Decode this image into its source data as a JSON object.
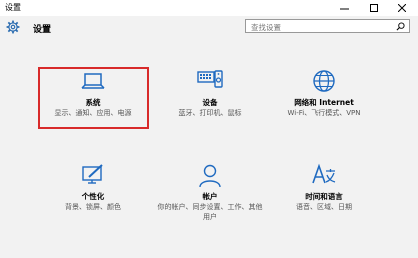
{
  "window": {
    "title": "设置"
  },
  "header": {
    "title": "设置",
    "search_placeholder": "查找设置"
  },
  "tiles": [
    {
      "title": "系统",
      "desc": "显示、通知、应用、电源",
      "icon": "laptop-icon"
    },
    {
      "title": "设备",
      "desc": "蓝牙、打印机、鼠标",
      "icon": "devices-icon"
    },
    {
      "title": "网络和 Internet",
      "desc": "Wi-Fi、飞行模式、VPN",
      "icon": "globe-icon"
    },
    {
      "title": "个性化",
      "desc": "背景、锁屏、颜色",
      "icon": "personalization-icon"
    },
    {
      "title": "帐户",
      "desc": "你的帐户、同步设置、工作、其他用户",
      "icon": "person-icon"
    },
    {
      "title": "时间和语言",
      "desc": "语音、区域、日期",
      "icon": "time-language-icon"
    }
  ],
  "colors": {
    "accent": "#1f6ac0",
    "selection": "#d82a2a"
  }
}
